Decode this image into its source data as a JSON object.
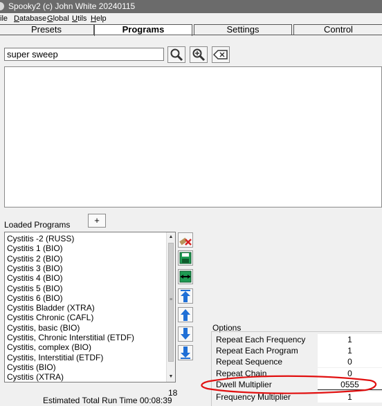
{
  "window": {
    "title": "Spooky2 (c) John White 20240115"
  },
  "menu": {
    "items": [
      {
        "label": "File",
        "shown": "ile",
        "underline": ""
      },
      {
        "label": "Database",
        "shown": "atabase",
        "underline": "D"
      },
      {
        "label": "Global",
        "shown": "lobal",
        "underline": "G"
      },
      {
        "label": "Utils",
        "shown": "tils",
        "underline": "U"
      },
      {
        "label": "Help",
        "shown": "elp",
        "underline": "H"
      }
    ]
  },
  "tabs": [
    {
      "label": "Presets",
      "active": false
    },
    {
      "label": "Programs",
      "active": true
    },
    {
      "label": "Settings",
      "active": false
    },
    {
      "label": "Control",
      "active": false
    }
  ],
  "search": {
    "value": "super sweep",
    "buttons": [
      "search-icon",
      "zoom-in-icon",
      "clear-icon"
    ]
  },
  "loaded_programs": {
    "label": "Loaded Programs",
    "add_label": "+",
    "items": [
      "Cystitis -2 (RUSS)",
      "Cystitis 1 (BIO)",
      "Cystitis 2 (BIO)",
      "Cystitis 3 (BIO)",
      "Cystitis 4 (BIO)",
      "Cystitis 5 (BIO)",
      "Cystitis 6 (BIO)",
      "Cystitis Bladder (XTRA)",
      "Cystitis Chronic (CAFL)",
      "Cystitis, basic (BIO)",
      "Cystitis, Chronic Interstitial (ETDF)",
      "Cystitis, complex (BIO)",
      "Cystitis, Interstitial (ETDF)",
      "Cystitis (BIO)",
      "Cystitis (XTRA)"
    ],
    "side_buttons": [
      "delete-icon",
      "save-icon",
      "save-swap-icon",
      "move-top-icon",
      "move-up-icon",
      "move-down-icon",
      "move-bottom-icon"
    ]
  },
  "runtime": {
    "count": "18",
    "label": "Estimated Total Run Time 00:08:39"
  },
  "options": {
    "title": "Options",
    "rows": [
      {
        "name": "Repeat Each Frequency",
        "value": "1"
      },
      {
        "name": "Repeat Each Program",
        "value": "1"
      },
      {
        "name": "Repeat Sequence",
        "value": "0"
      },
      {
        "name": "Repeat Chain",
        "value": "0"
      },
      {
        "name": "Dwell Multiplier",
        "value": "0555"
      },
      {
        "name": "Frequency Multiplier",
        "value": "1"
      }
    ]
  },
  "colors": {
    "titlebar": "#6b6b6b",
    "arrow_blue": "#1f6fd6",
    "annotation_red": "#e11010"
  }
}
